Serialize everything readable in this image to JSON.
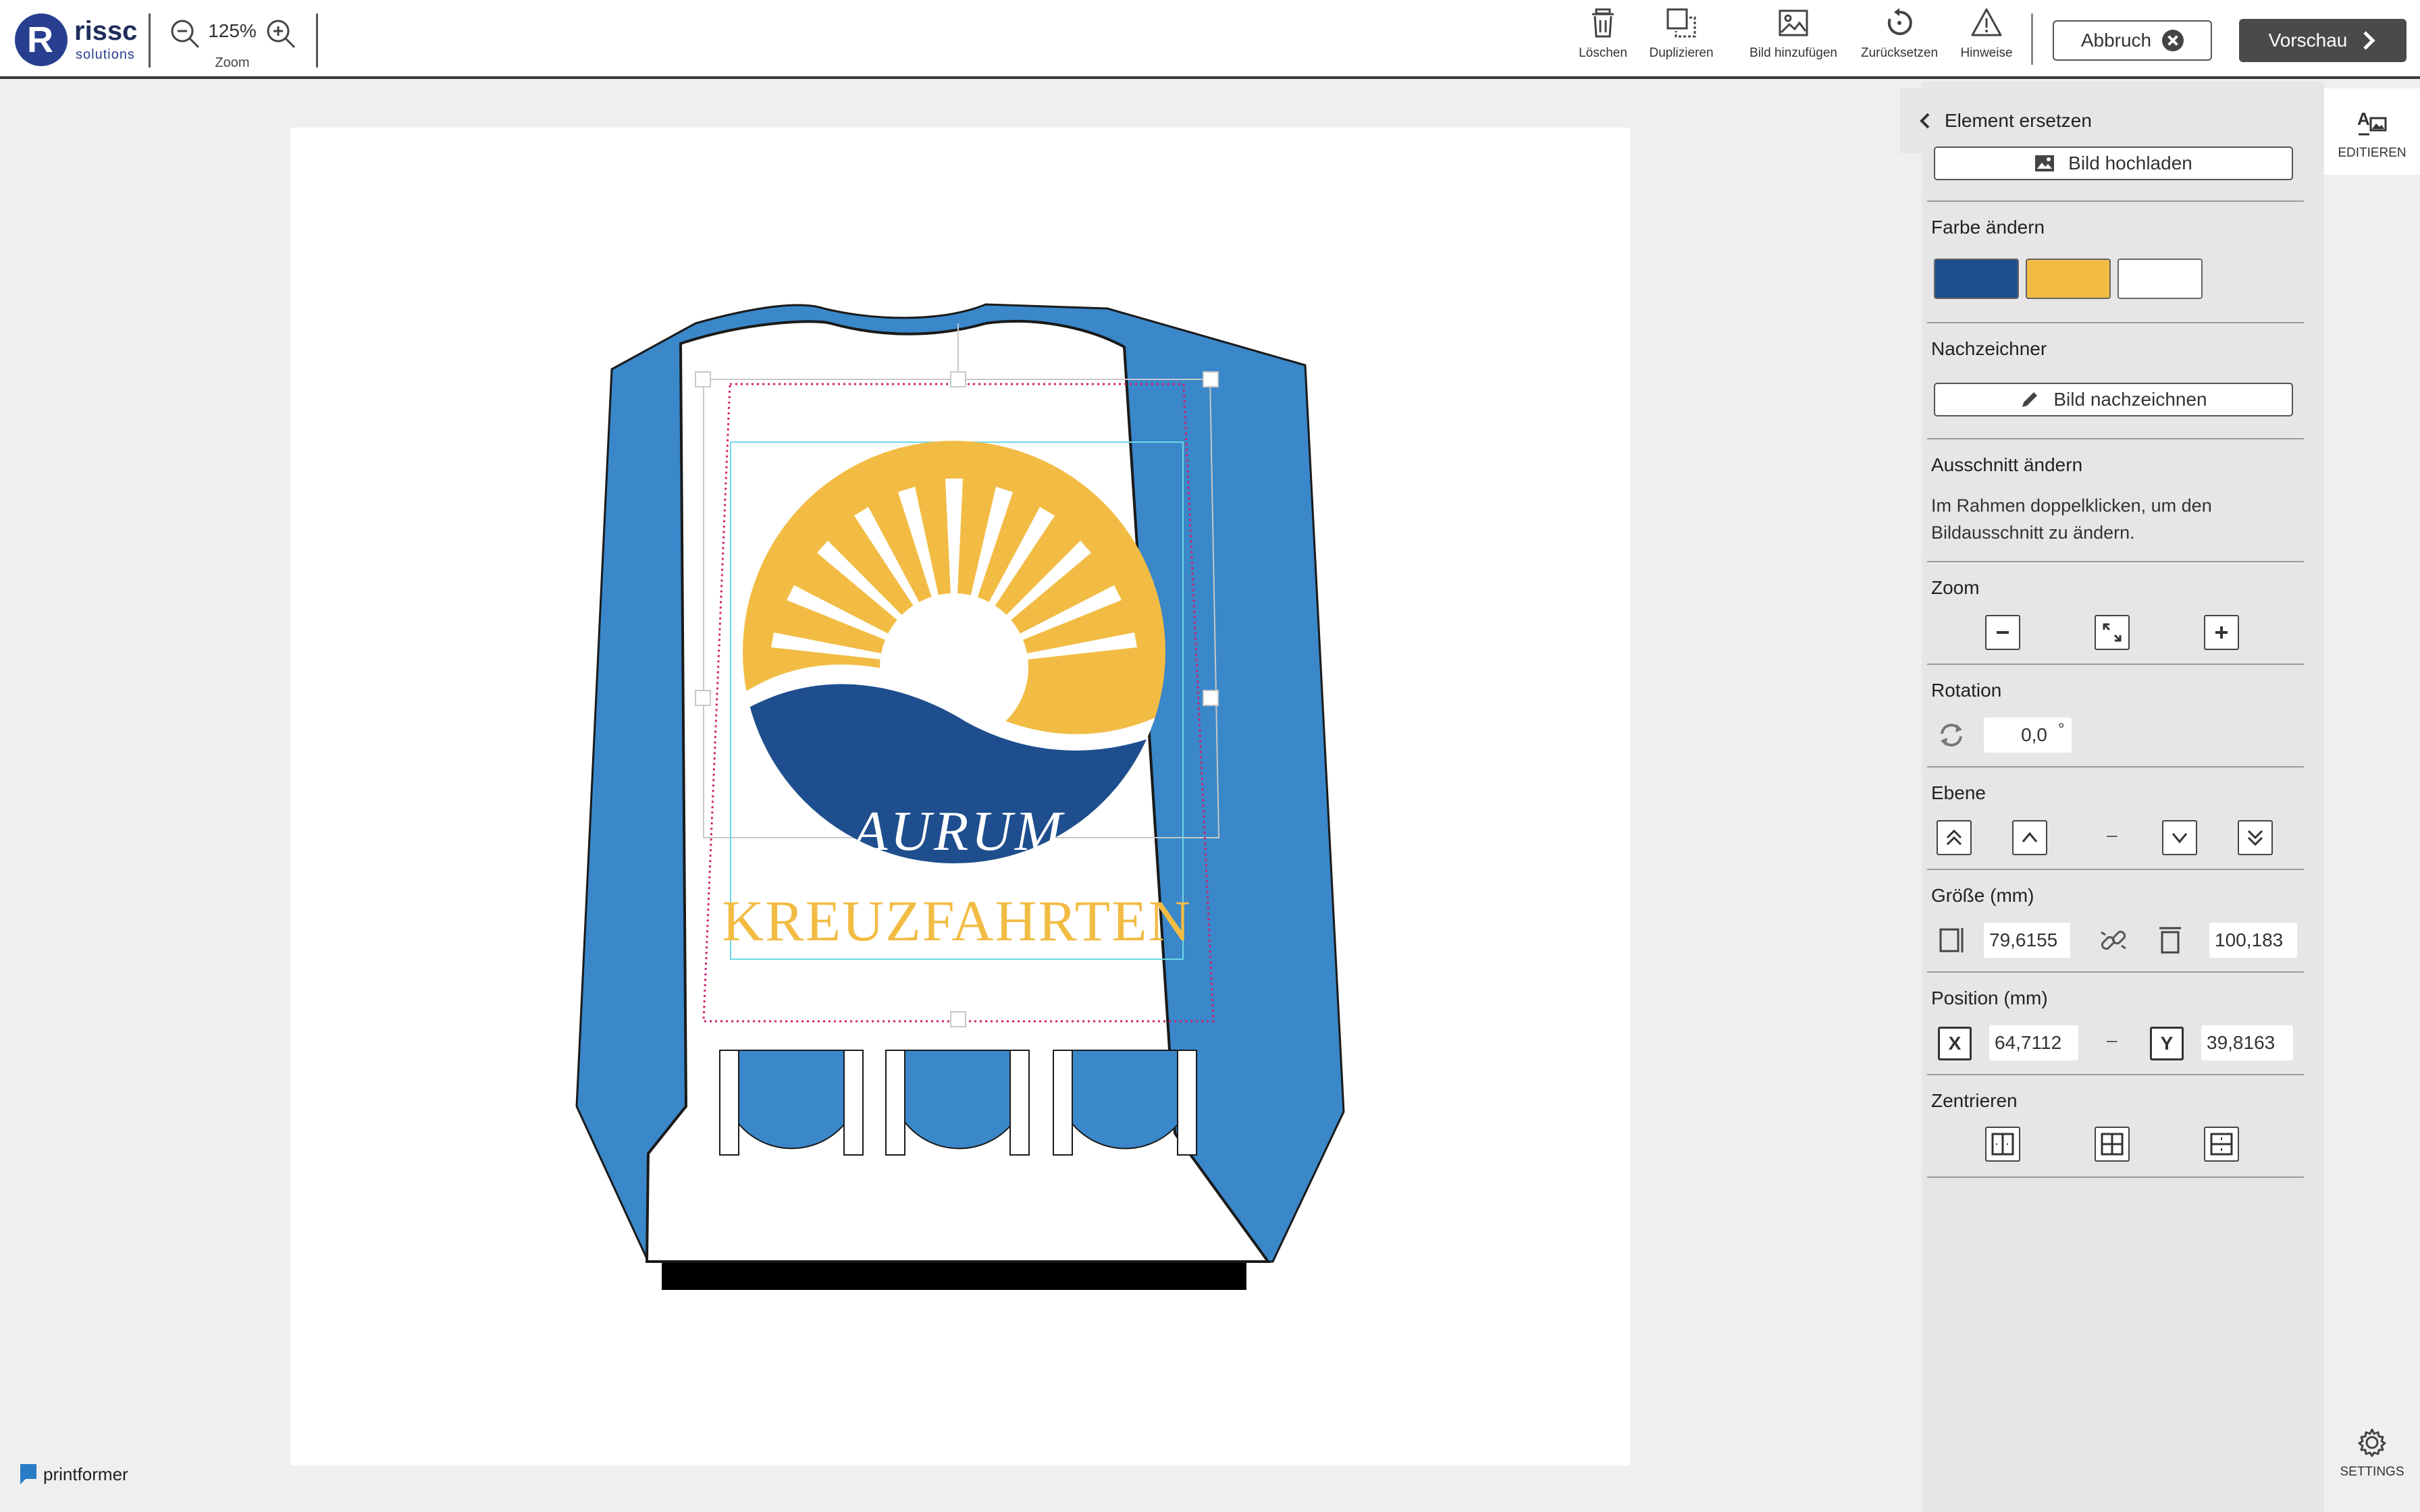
{
  "brand": {
    "name": "rissc",
    "sub": "solutions"
  },
  "zoom": {
    "value": "125%",
    "label": "Zoom"
  },
  "toolbar": {
    "delete": "Löschen",
    "duplicate": "Duplizieren",
    "add_image": "Bild hinzufügen",
    "reset": "Zurücksetzen",
    "hints": "Hinweise",
    "cancel": "Abbruch",
    "preview": "Vorschau"
  },
  "artwork": {
    "logo_word": "AURUM",
    "logo_subword": "KREUZFAHRTEN",
    "colors": {
      "blue": "#1e4e8e",
      "yellow": "#f2bc44",
      "garment_blue": "#3a87c9"
    }
  },
  "footer": {
    "product": "printformer"
  },
  "panel": {
    "title": "Element ersetzen",
    "upload_label": "Bild hochladen",
    "color_title": "Farbe ändern",
    "swatches": [
      "#1e4e8e",
      "#f2bc44",
      "#ffffff"
    ],
    "retrace_title": "Nachzeichner",
    "retrace_label": "Bild nachzeichnen",
    "crop_title": "Ausschnitt ändern",
    "crop_text": "Im Rahmen doppelklicken, um den Bildausschnitt zu ändern.",
    "zoom_title": "Zoom",
    "rotation_title": "Rotation",
    "rotation_value": "0,0",
    "rotation_unit": "°",
    "layer_title": "Ebene",
    "size_title": "Größe (mm)",
    "width_value": "79,6155",
    "height_value": "100,183",
    "position_title": "Position (mm)",
    "x_label": "X",
    "x_value": "64,7112",
    "y_label": "Y",
    "y_value": "39,8163",
    "center_title": "Zentrieren",
    "dash": "–"
  },
  "rail": {
    "edit_label": "EDITIEREN",
    "settings_label": "SETTINGS"
  }
}
